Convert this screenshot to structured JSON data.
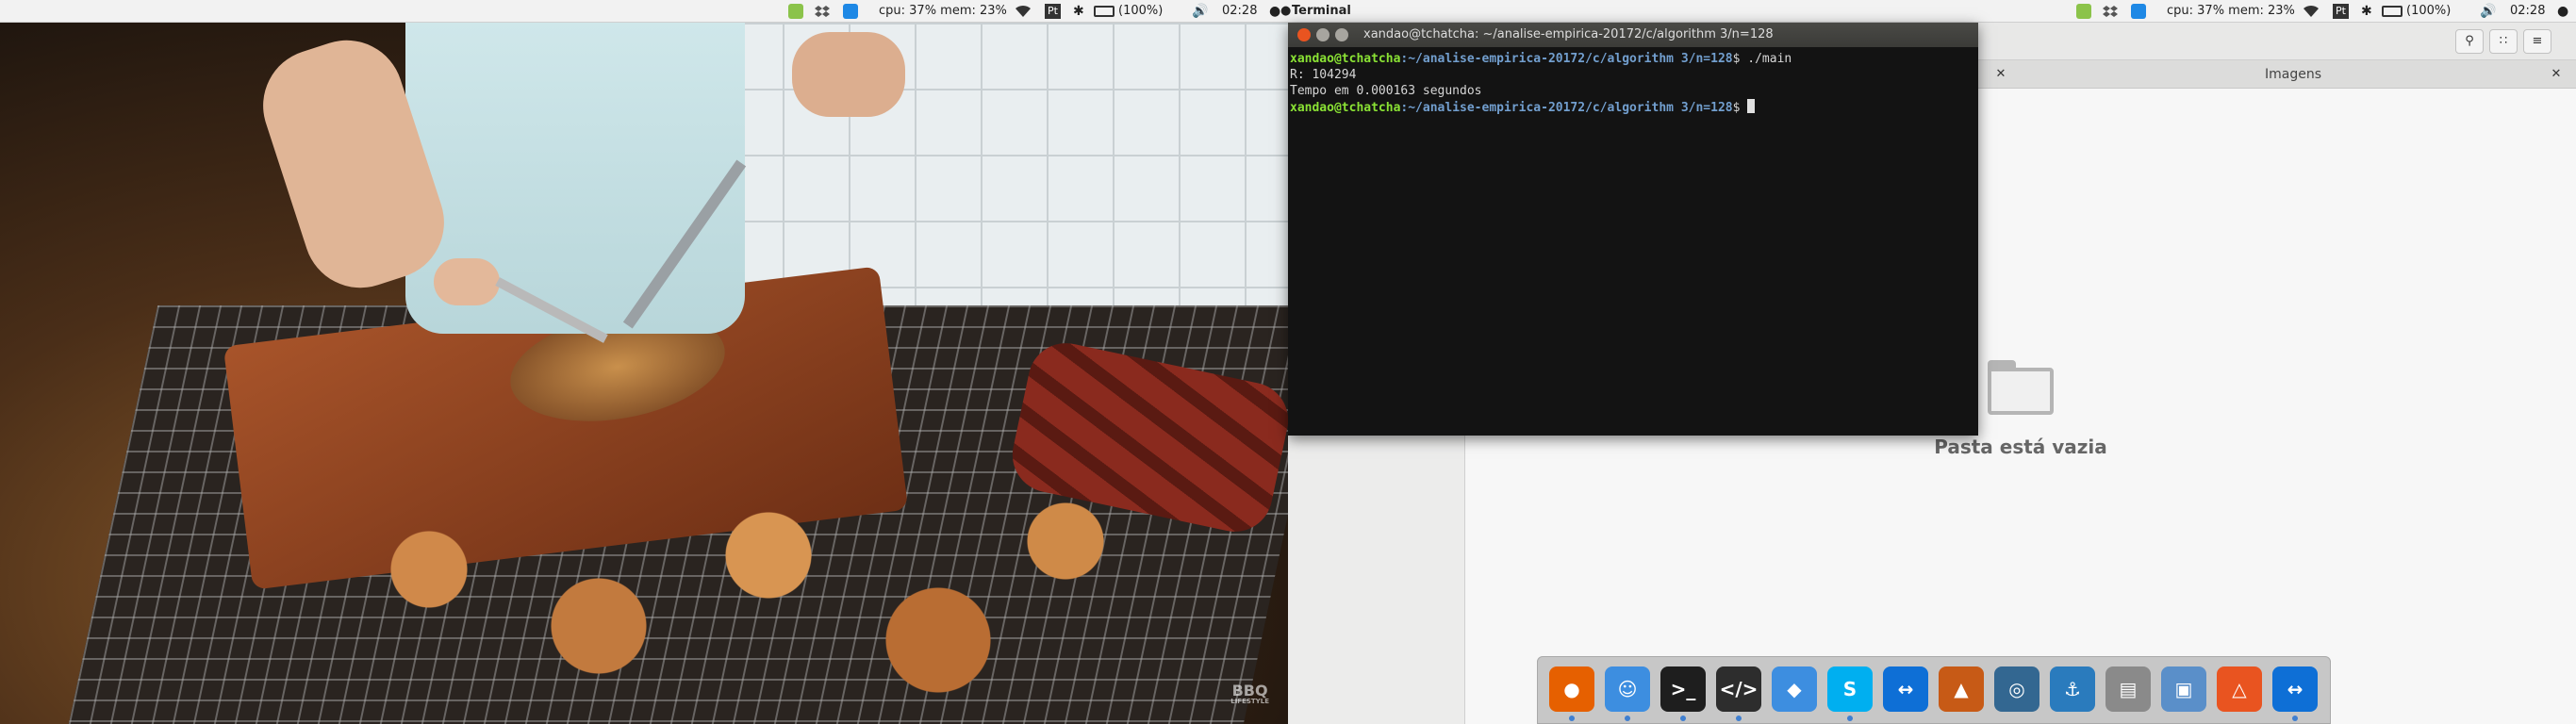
{
  "topbar": {
    "cpu_mem": "cpu: 37% mem: 23%",
    "battery": "(100%)",
    "clock": "02:28",
    "active_app": "Terminal",
    "icons": [
      "green-status-icon",
      "dropbox-icon",
      "teamviewer-icon",
      "wifi-icon",
      "keyboard-layout-icon",
      "bluetooth-icon",
      "battery-icon",
      "volume-icon",
      "apple-icon"
    ],
    "keyboard_label": "Pt"
  },
  "wallpaper": {
    "watermark_line1": "BBQ",
    "watermark_line2": "LIFESTYLE"
  },
  "terminal": {
    "title": "xandao@tchatcha: ~/analise-empirica-20172/c/algorithm 3/n=128",
    "prompt_user": "xandao@tchatcha",
    "prompt_path": ":~/analise-empirica-20172/c/algorithm 3/n=128",
    "prompt_symbol": "$",
    "command": " ./main",
    "output_line1": "R: 104294",
    "output_line2": "Tempo em 0.000163 segundos"
  },
  "files": {
    "tab_label": "Imagens",
    "empty_message": "Pasta está vazia"
  },
  "dock": {
    "items": [
      {
        "name": "firefox",
        "color": "#e66000",
        "glyph": "●",
        "running": true
      },
      {
        "name": "finder",
        "color": "#3d8ee0",
        "glyph": "☺",
        "running": true
      },
      {
        "name": "terminal",
        "color": "#1e1e1e",
        "glyph": ">_",
        "running": true
      },
      {
        "name": "code-editor",
        "color": "#2d2d2d",
        "glyph": "</>",
        "running": true
      },
      {
        "name": "dropbox",
        "color": "#3d8ee0",
        "glyph": "◆",
        "running": false
      },
      {
        "name": "skype",
        "color": "#00aff0",
        "glyph": "S",
        "running": true
      },
      {
        "name": "teamviewer",
        "color": "#0e6fd6",
        "glyph": "↔",
        "running": false
      },
      {
        "name": "matlab",
        "color": "#c75a16",
        "glyph": "▲",
        "running": false
      },
      {
        "name": "postgresql",
        "color": "#336791",
        "glyph": "◎",
        "running": false
      },
      {
        "name": "mysql-workbench",
        "color": "#2a7bbd",
        "glyph": "⚓",
        "running": false
      },
      {
        "name": "disk-utility",
        "color": "#8a8a8a",
        "glyph": "▤",
        "running": false
      },
      {
        "name": "virtualbox",
        "color": "#5a8fc9",
        "glyph": "▣",
        "running": false
      },
      {
        "name": "ubuntu-software",
        "color": "#e95420",
        "glyph": "△",
        "running": false
      },
      {
        "name": "teamviewer-2",
        "color": "#0e6fd6",
        "glyph": "↔",
        "running": true
      }
    ]
  }
}
